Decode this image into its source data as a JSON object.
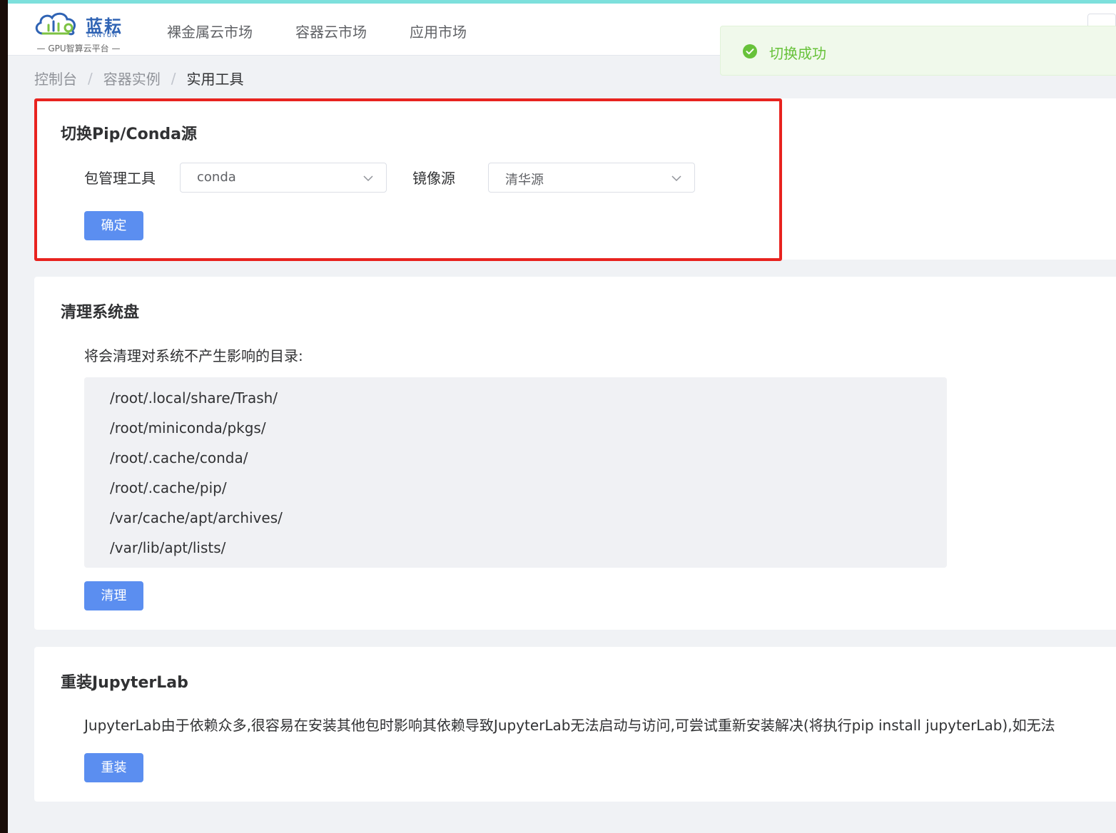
{
  "brand": {
    "name_cn": "蓝耘",
    "name_en": "LANYUN",
    "subtitle": "GPU智算云平台",
    "colors": {
      "logo_blue": "#2f63b4",
      "logo_green": "#7cc242"
    }
  },
  "nav": {
    "items": [
      "裸金属云市场",
      "容器云市场",
      "应用市场"
    ]
  },
  "toast": {
    "icon": "check-circle-icon",
    "message": "切换成功",
    "color": "#67c23a"
  },
  "breadcrumb": {
    "items": [
      "控制台",
      "容器实例",
      "实用工具"
    ],
    "separator": "/"
  },
  "pip_conda": {
    "title": "切换Pip/Conda源",
    "tool_label": "包管理工具",
    "tool_value": "conda",
    "mirror_label": "镜像源",
    "mirror_value": "清华源",
    "confirm_label": "确定"
  },
  "clean_disk": {
    "title": "清理系统盘",
    "description": "将会清理对系统不产生影响的目录:",
    "paths": [
      "/root/.local/share/Trash/",
      "/root/miniconda/pkgs/",
      "/root/.cache/conda/",
      "/root/.cache/pip/",
      "/var/cache/apt/archives/",
      "/var/lib/apt/lists/"
    ],
    "button_label": "清理"
  },
  "reinstall": {
    "title": "重装JupyterLab",
    "description": "JupyterLab由于依赖众多,很容易在安装其他包时影响其依赖导致JupyterLab无法启动与访问,可尝试重新安装解决(将执行pip install jupyterLab),如无法",
    "button_label": "重装"
  },
  "theme": {
    "primary_button": "#5b8ef0",
    "highlight_border": "#e8231f",
    "page_bg": "#f0f2f5"
  }
}
